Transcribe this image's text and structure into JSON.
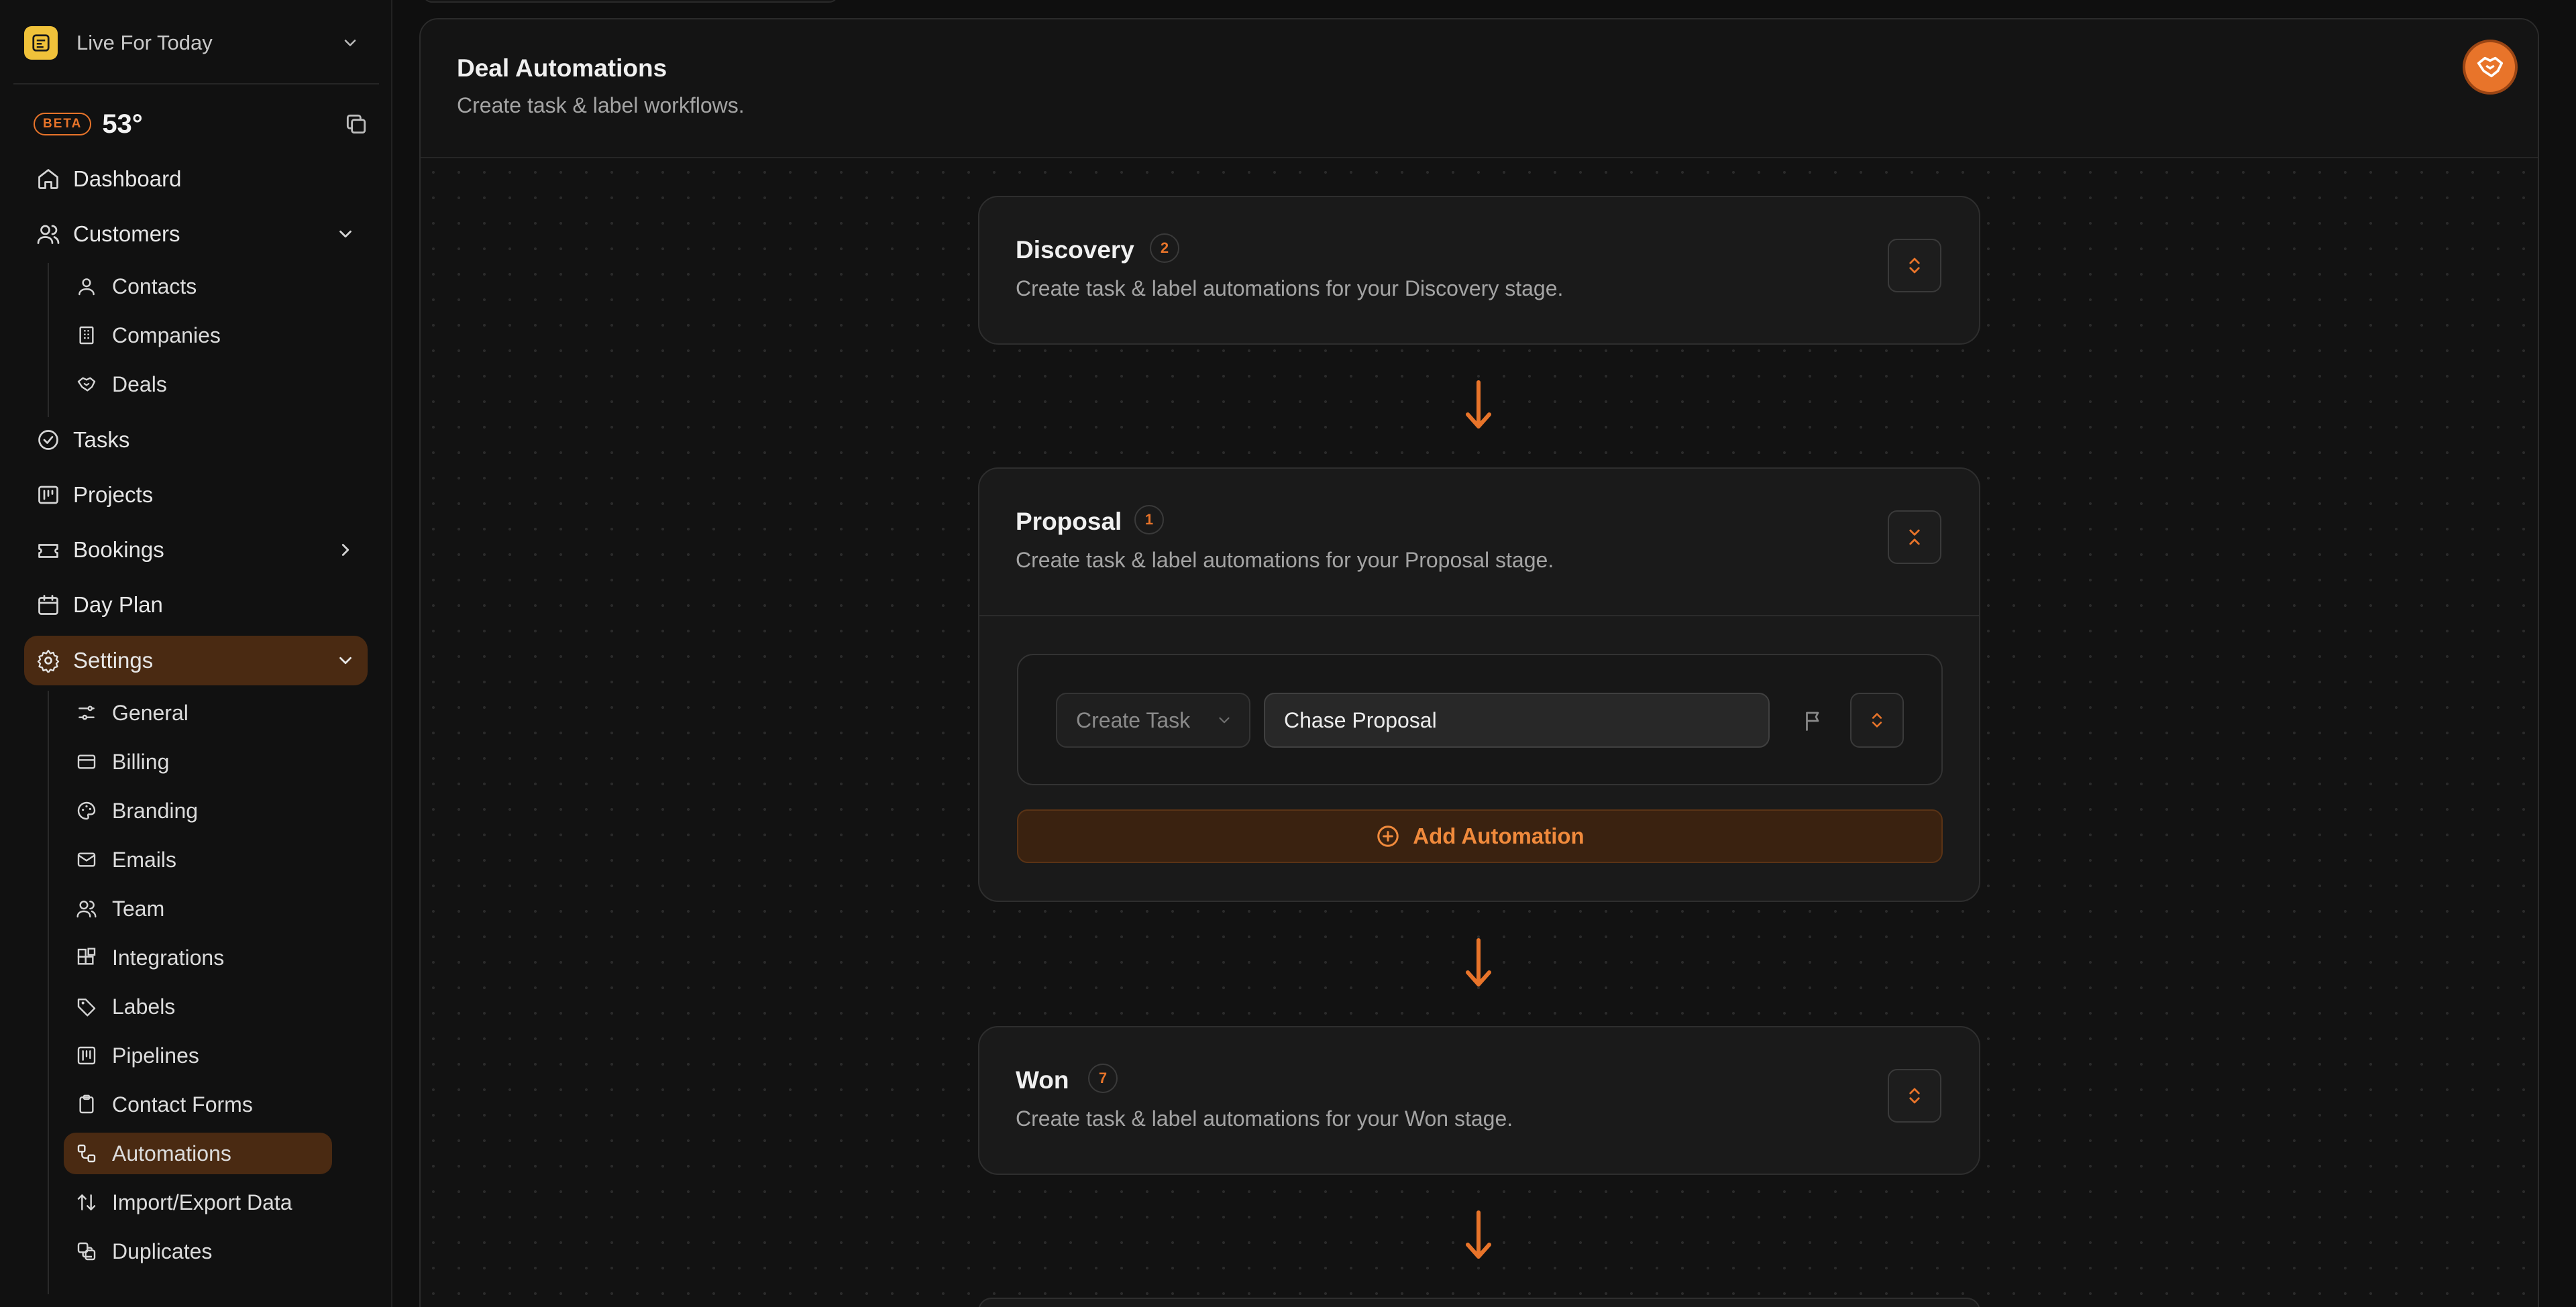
{
  "workspace": {
    "name": "Live For Today"
  },
  "brand": {
    "beta_label": "BETA",
    "temperature": "53°"
  },
  "colors": {
    "accent": "#e8742a",
    "active_bg": "#4a2a12",
    "background": "#0f0f0f",
    "logo": "#f0c23a"
  },
  "nav": {
    "dashboard": "Dashboard",
    "customers": "Customers",
    "contacts": "Contacts",
    "companies": "Companies",
    "deals": "Deals",
    "tasks": "Tasks",
    "projects": "Projects",
    "bookings": "Bookings",
    "day_plan": "Day Plan",
    "settings": "Settings",
    "general": "General",
    "billing": "Billing",
    "branding": "Branding",
    "emails": "Emails",
    "team": "Team",
    "integrations": "Integrations",
    "labels": "Labels",
    "pipelines": "Pipelines",
    "contact_forms": "Contact Forms",
    "automations": "Automations",
    "import_export": "Import/Export Data",
    "duplicates": "Duplicates"
  },
  "page": {
    "title": "Deal Automations",
    "subtitle": "Create task & label workflows."
  },
  "stages": [
    {
      "name": "Discovery",
      "count": "2",
      "description": "Create task & label automations for your Discovery stage.",
      "expanded": false
    },
    {
      "name": "Proposal",
      "count": "1",
      "description": "Create task & label automations for your Proposal stage.",
      "expanded": true,
      "automation": {
        "action": "Create Task",
        "value": "Chase Proposal"
      },
      "add_label": "Add Automation"
    },
    {
      "name": "Won",
      "count": "7",
      "description": "Create task & label automations for your Won stage.",
      "expanded": false
    }
  ]
}
